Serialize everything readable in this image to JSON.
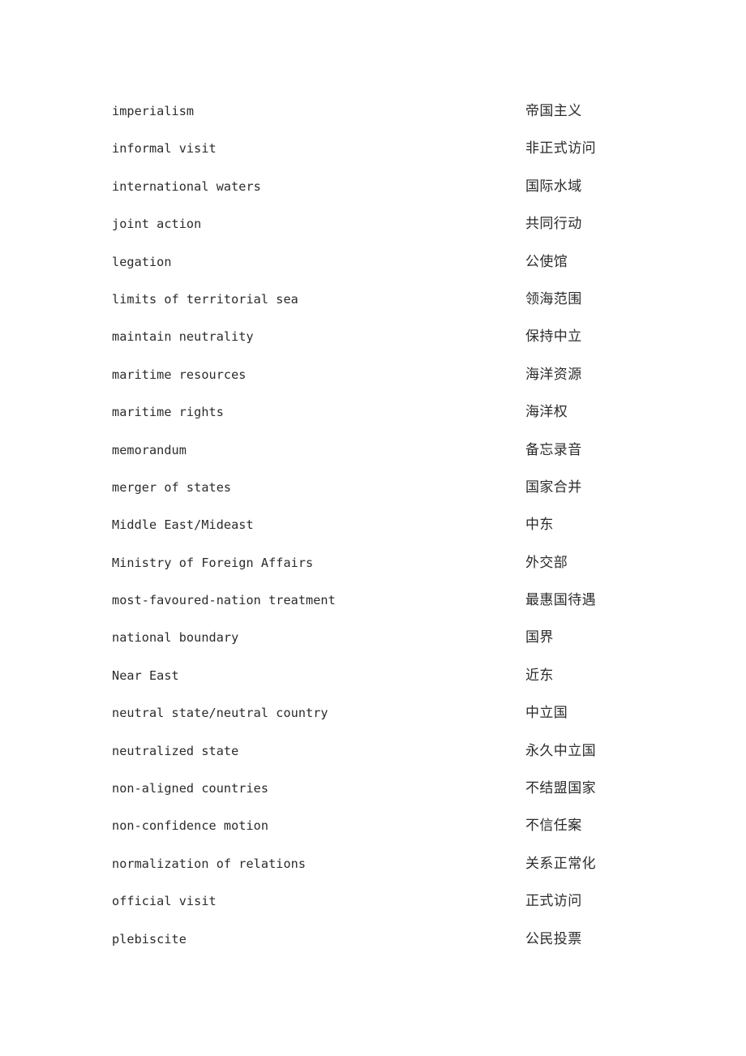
{
  "document": {
    "type": "bilingual-glossary",
    "page_background": "#ffffff",
    "text_color": "#2b2b2b",
    "columns": {
      "left_header": "",
      "right_header": ""
    },
    "entries": [
      {
        "en": "imperialism",
        "zh": "帝国主义"
      },
      {
        "en": "informal visit",
        "zh": "非正式访问"
      },
      {
        "en": "international waters",
        "zh": "国际水域"
      },
      {
        "en": "joint action",
        "zh": "共同行动"
      },
      {
        "en": "legation",
        "zh": "公使馆"
      },
      {
        "en": "limits of territorial sea",
        "zh": "领海范围"
      },
      {
        "en": "maintain neutrality",
        "zh": "保持中立"
      },
      {
        "en": "maritime resources",
        "zh": "海洋资源"
      },
      {
        "en": "maritime rights",
        "zh": "海洋权"
      },
      {
        "en": "memorandum",
        "zh": "备忘录音"
      },
      {
        "en": "merger of states",
        "zh": "国家合并"
      },
      {
        "en": "Middle East/Mideast",
        "zh": "中东"
      },
      {
        "en": "Ministry of Foreign Affairs",
        "zh": "外交部"
      },
      {
        "en": "most-favoured-nation treatment",
        "zh": "最惠国待遇"
      },
      {
        "en": "national boundary",
        "zh": "国界"
      },
      {
        "en": "Near East",
        "zh": "近东"
      },
      {
        "en": "neutral state/neutral country",
        "zh": "中立国"
      },
      {
        "en": "neutralized state",
        "zh": "永久中立国"
      },
      {
        "en": "non-aligned countries",
        "zh": "不结盟国家"
      },
      {
        "en": "non-confidence motion",
        "zh": "不信任案"
      },
      {
        "en": "normalization of relations",
        "zh": "关系正常化"
      },
      {
        "en": "official visit",
        "zh": "正式访问"
      },
      {
        "en": "plebiscite",
        "zh": "公民投票"
      }
    ]
  }
}
